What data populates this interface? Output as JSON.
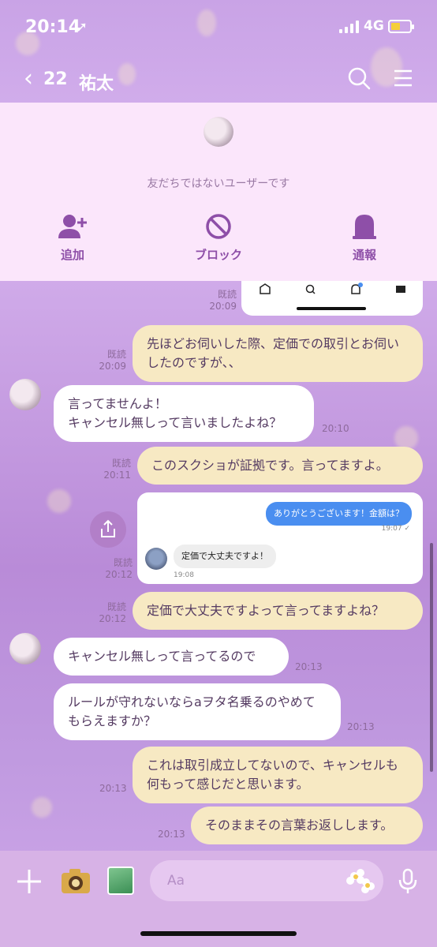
{
  "status": {
    "time": "20:14",
    "network": "4G"
  },
  "nav": {
    "back_count": "22",
    "contact_name": "祐太"
  },
  "header": {
    "notice": "友だちではないユーザーです",
    "actions": [
      {
        "label": "追加"
      },
      {
        "label": "ブロック"
      },
      {
        "label": "通報"
      }
    ]
  },
  "messages": [
    {
      "side": "me",
      "read": "既読",
      "time": "20:09",
      "text": ""
    },
    {
      "side": "me",
      "read": "既読",
      "time": "20:09",
      "text": "先ほどお伺いした際、定価での取引とお伺いしたのですが、、"
    },
    {
      "side": "them",
      "time": "20:10",
      "text": "言ってませんよ！\nキャンセル無しって言いましたよね？"
    },
    {
      "side": "me",
      "read": "既読",
      "time": "20:11",
      "text": "このスクショが証拠です。言ってますよ。"
    },
    {
      "side": "me",
      "read": "既読",
      "time": "20:12",
      "text": ""
    },
    {
      "side": "me",
      "read": "既読",
      "time": "20:12",
      "text": "定価で大丈夫ですよって言ってますよね？"
    },
    {
      "side": "them",
      "time": "20:13",
      "text": "キャンセル無しって言ってるので"
    },
    {
      "side": "them",
      "time": "20:13",
      "text": "ルールが守れないならaヲタ名乗るのやめてもらえますか？"
    },
    {
      "side": "me",
      "time": "20:13",
      "text": "これは取引成立してないので、キャンセルも何もって感じだと思います。"
    },
    {
      "side": "me",
      "time": "20:13",
      "text": "そのままその言葉お返しします。"
    }
  ],
  "screenshot": {
    "sent_text": "ありがとうございます！金額は？",
    "sent_time": "19:07 ✓",
    "reply_text": "定価で大丈夫ですよ！",
    "reply_time": "19:08"
  },
  "input": {
    "placeholder": "Aa"
  },
  "colors": {
    "accent": "#8e4fa8",
    "bubble_me": "#f7e9c3",
    "bubble_them": "#ffffff",
    "panel": "#fbe6fb"
  }
}
